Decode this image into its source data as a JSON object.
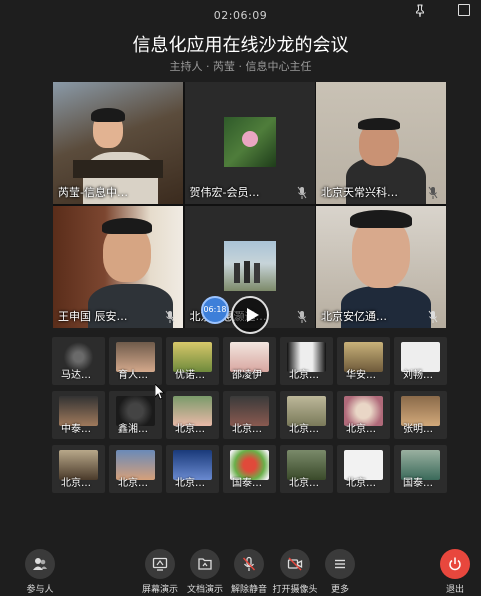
{
  "header": {
    "timer": "02:06:09",
    "title": "信息化应用在线沙龙的会议",
    "subtitle": "主持人 · 芮莹 · 信息中心主任"
  },
  "video_tiles": [
    {
      "name": "芮莹-信息中…",
      "muted": false
    },
    {
      "name": "贺伟宏-会员…",
      "muted": true
    },
    {
      "name": "北京天常兴科…",
      "muted": true
    },
    {
      "name": "王申国 辰安…",
      "muted": true
    },
    {
      "name": "北京中惠灏远…",
      "muted": true
    },
    {
      "name": "北京安亿通…",
      "muted": true
    }
  ],
  "overlay": {
    "badge_time": "06:18"
  },
  "avatar_rows": [
    [
      "马达…",
      "育人…",
      "优诺…",
      "邵凌伊",
      "北京…",
      "华安…",
      "刘畅…"
    ],
    [
      "中泰…",
      "鑫湘…",
      "北京…",
      "北京…",
      "北京…",
      "北京…",
      "张明…"
    ],
    [
      "北京…",
      "北京…",
      "北京…",
      "国泰…",
      "北京…",
      "北京…",
      "国泰…"
    ]
  ],
  "toolbar": {
    "participants": "参与人",
    "screen_share": "屏幕演示",
    "doc_share": "文档演示",
    "unmute": "解除静音",
    "camera": "打开摄像头",
    "more": "更多",
    "exit": "退出"
  },
  "colors": {
    "background": "#1e1e1e",
    "exit_red": "#e8473d",
    "accent_blue": "#3d7fd9"
  }
}
